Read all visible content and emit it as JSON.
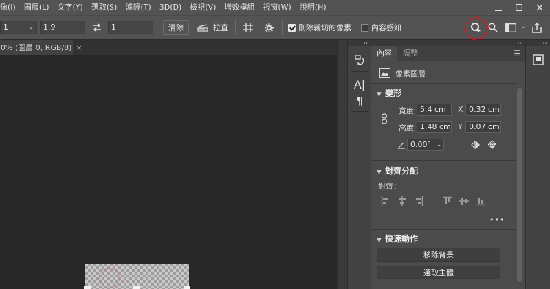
{
  "menubar": {
    "items": [
      "像(I)",
      "圖層(L)",
      "文字(Y)",
      "選取(S)",
      "濾鏡(T)",
      "3D(D)",
      "檢視(V)",
      "增效模組",
      "視窗(W)",
      "說明(H)"
    ]
  },
  "window_controls": {
    "minimize": "—",
    "maximize": "☐",
    "close": "✕"
  },
  "optbar": {
    "field1_value": "1",
    "field2_value": "1.9",
    "field3_value": "1",
    "clear_label": "清除",
    "straighten_label": "拉直",
    "delete_cropped_label": "刪除裁切的像素",
    "delete_cropped_checked": true,
    "content_aware_label": "內容感知",
    "content_aware_checked": false,
    "highlight_color": "#e0131c"
  },
  "document": {
    "tab_label": "0% (圖層 0, RGB/8)",
    "tab_close": "×"
  },
  "properties": {
    "tabs": [
      "內容",
      "調整"
    ],
    "layer_type": "像素圖層",
    "transform": {
      "title": "變形",
      "width_label": "寬度",
      "width_value": "5.4 cm",
      "x_label": "X",
      "x_value": "0.32 cm",
      "height_label": "高度",
      "height_value": "1.48 cm",
      "y_label": "Y",
      "y_value": "0.07 cm",
      "angle_value": "0.00°"
    },
    "align": {
      "title": "對齊分配",
      "label": "對齊：",
      "more": "•••"
    },
    "quick_actions": {
      "title": "快速動作",
      "remove_bg": "移除背景",
      "select_subject": "選取主體"
    }
  }
}
